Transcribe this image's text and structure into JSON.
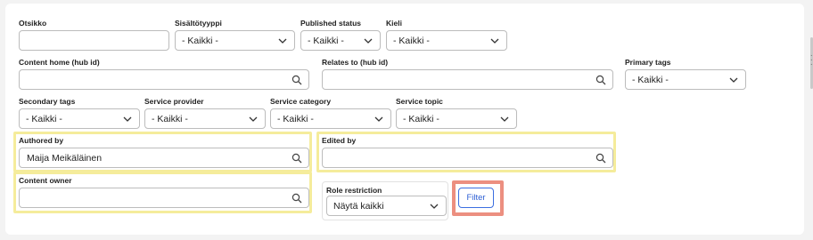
{
  "filters": {
    "otsikko": {
      "label": "Otsikko",
      "value": ""
    },
    "sisaltotyyppi": {
      "label": "Sisältötyyppi",
      "value": "- Kaikki -"
    },
    "published_status": {
      "label": "Published status",
      "value": "- Kaikki -"
    },
    "kieli": {
      "label": "Kieli",
      "value": "- Kaikki -"
    },
    "content_home": {
      "label": "Content home (hub id)",
      "value": ""
    },
    "relates_to": {
      "label": "Relates to (hub id)",
      "value": ""
    },
    "primary_tags": {
      "label": "Primary tags",
      "value": "- Kaikki -"
    },
    "secondary_tags": {
      "label": "Secondary tags",
      "value": "- Kaikki -"
    },
    "service_provider": {
      "label": "Service provider",
      "value": "- Kaikki -"
    },
    "service_category": {
      "label": "Service category",
      "value": "- Kaikki -"
    },
    "service_topic": {
      "label": "Service topic",
      "value": "- Kaikki -"
    },
    "authored_by": {
      "label": "Authored by",
      "value": "Maija Meikäläinen"
    },
    "edited_by": {
      "label": "Edited by",
      "value": ""
    },
    "content_owner": {
      "label": "Content owner",
      "value": ""
    },
    "role_restriction": {
      "label": "Role restriction",
      "value": "Näytä kaikki"
    }
  },
  "actions": {
    "filter_label": "Filter"
  },
  "colors": {
    "highlight_yellow": "#f5ec9b",
    "highlight_red": "#ec8f80",
    "accent_blue": "#3c6fe0"
  },
  "icons": {
    "search": "search-icon",
    "chevron": "chevron-down-icon"
  }
}
